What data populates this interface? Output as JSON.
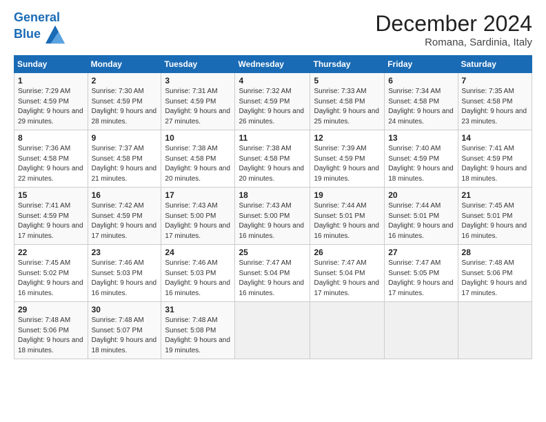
{
  "header": {
    "logo_line1": "General",
    "logo_line2": "Blue",
    "month": "December 2024",
    "location": "Romana, Sardinia, Italy"
  },
  "days_of_week": [
    "Sunday",
    "Monday",
    "Tuesday",
    "Wednesday",
    "Thursday",
    "Friday",
    "Saturday"
  ],
  "weeks": [
    [
      {
        "day": "1",
        "sunrise": "Sunrise: 7:29 AM",
        "sunset": "Sunset: 4:59 PM",
        "daylight": "Daylight: 9 hours and 29 minutes."
      },
      {
        "day": "2",
        "sunrise": "Sunrise: 7:30 AM",
        "sunset": "Sunset: 4:59 PM",
        "daylight": "Daylight: 9 hours and 28 minutes."
      },
      {
        "day": "3",
        "sunrise": "Sunrise: 7:31 AM",
        "sunset": "Sunset: 4:59 PM",
        "daylight": "Daylight: 9 hours and 27 minutes."
      },
      {
        "day": "4",
        "sunrise": "Sunrise: 7:32 AM",
        "sunset": "Sunset: 4:59 PM",
        "daylight": "Daylight: 9 hours and 26 minutes."
      },
      {
        "day": "5",
        "sunrise": "Sunrise: 7:33 AM",
        "sunset": "Sunset: 4:58 PM",
        "daylight": "Daylight: 9 hours and 25 minutes."
      },
      {
        "day": "6",
        "sunrise": "Sunrise: 7:34 AM",
        "sunset": "Sunset: 4:58 PM",
        "daylight": "Daylight: 9 hours and 24 minutes."
      },
      {
        "day": "7",
        "sunrise": "Sunrise: 7:35 AM",
        "sunset": "Sunset: 4:58 PM",
        "daylight": "Daylight: 9 hours and 23 minutes."
      }
    ],
    [
      {
        "day": "8",
        "sunrise": "Sunrise: 7:36 AM",
        "sunset": "Sunset: 4:58 PM",
        "daylight": "Daylight: 9 hours and 22 minutes."
      },
      {
        "day": "9",
        "sunrise": "Sunrise: 7:37 AM",
        "sunset": "Sunset: 4:58 PM",
        "daylight": "Daylight: 9 hours and 21 minutes."
      },
      {
        "day": "10",
        "sunrise": "Sunrise: 7:38 AM",
        "sunset": "Sunset: 4:58 PM",
        "daylight": "Daylight: 9 hours and 20 minutes."
      },
      {
        "day": "11",
        "sunrise": "Sunrise: 7:38 AM",
        "sunset": "Sunset: 4:58 PM",
        "daylight": "Daylight: 9 hours and 20 minutes."
      },
      {
        "day": "12",
        "sunrise": "Sunrise: 7:39 AM",
        "sunset": "Sunset: 4:59 PM",
        "daylight": "Daylight: 9 hours and 19 minutes."
      },
      {
        "day": "13",
        "sunrise": "Sunrise: 7:40 AM",
        "sunset": "Sunset: 4:59 PM",
        "daylight": "Daylight: 9 hours and 18 minutes."
      },
      {
        "day": "14",
        "sunrise": "Sunrise: 7:41 AM",
        "sunset": "Sunset: 4:59 PM",
        "daylight": "Daylight: 9 hours and 18 minutes."
      }
    ],
    [
      {
        "day": "15",
        "sunrise": "Sunrise: 7:41 AM",
        "sunset": "Sunset: 4:59 PM",
        "daylight": "Daylight: 9 hours and 17 minutes."
      },
      {
        "day": "16",
        "sunrise": "Sunrise: 7:42 AM",
        "sunset": "Sunset: 4:59 PM",
        "daylight": "Daylight: 9 hours and 17 minutes."
      },
      {
        "day": "17",
        "sunrise": "Sunrise: 7:43 AM",
        "sunset": "Sunset: 5:00 PM",
        "daylight": "Daylight: 9 hours and 17 minutes."
      },
      {
        "day": "18",
        "sunrise": "Sunrise: 7:43 AM",
        "sunset": "Sunset: 5:00 PM",
        "daylight": "Daylight: 9 hours and 16 minutes."
      },
      {
        "day": "19",
        "sunrise": "Sunrise: 7:44 AM",
        "sunset": "Sunset: 5:01 PM",
        "daylight": "Daylight: 9 hours and 16 minutes."
      },
      {
        "day": "20",
        "sunrise": "Sunrise: 7:44 AM",
        "sunset": "Sunset: 5:01 PM",
        "daylight": "Daylight: 9 hours and 16 minutes."
      },
      {
        "day": "21",
        "sunrise": "Sunrise: 7:45 AM",
        "sunset": "Sunset: 5:01 PM",
        "daylight": "Daylight: 9 hours and 16 minutes."
      }
    ],
    [
      {
        "day": "22",
        "sunrise": "Sunrise: 7:45 AM",
        "sunset": "Sunset: 5:02 PM",
        "daylight": "Daylight: 9 hours and 16 minutes."
      },
      {
        "day": "23",
        "sunrise": "Sunrise: 7:46 AM",
        "sunset": "Sunset: 5:03 PM",
        "daylight": "Daylight: 9 hours and 16 minutes."
      },
      {
        "day": "24",
        "sunrise": "Sunrise: 7:46 AM",
        "sunset": "Sunset: 5:03 PM",
        "daylight": "Daylight: 9 hours and 16 minutes."
      },
      {
        "day": "25",
        "sunrise": "Sunrise: 7:47 AM",
        "sunset": "Sunset: 5:04 PM",
        "daylight": "Daylight: 9 hours and 16 minutes."
      },
      {
        "day": "26",
        "sunrise": "Sunrise: 7:47 AM",
        "sunset": "Sunset: 5:04 PM",
        "daylight": "Daylight: 9 hours and 17 minutes."
      },
      {
        "day": "27",
        "sunrise": "Sunrise: 7:47 AM",
        "sunset": "Sunset: 5:05 PM",
        "daylight": "Daylight: 9 hours and 17 minutes."
      },
      {
        "day": "28",
        "sunrise": "Sunrise: 7:48 AM",
        "sunset": "Sunset: 5:06 PM",
        "daylight": "Daylight: 9 hours and 17 minutes."
      }
    ],
    [
      {
        "day": "29",
        "sunrise": "Sunrise: 7:48 AM",
        "sunset": "Sunset: 5:06 PM",
        "daylight": "Daylight: 9 hours and 18 minutes."
      },
      {
        "day": "30",
        "sunrise": "Sunrise: 7:48 AM",
        "sunset": "Sunset: 5:07 PM",
        "daylight": "Daylight: 9 hours and 18 minutes."
      },
      {
        "day": "31",
        "sunrise": "Sunrise: 7:48 AM",
        "sunset": "Sunset: 5:08 PM",
        "daylight": "Daylight: 9 hours and 19 minutes."
      },
      null,
      null,
      null,
      null
    ]
  ]
}
